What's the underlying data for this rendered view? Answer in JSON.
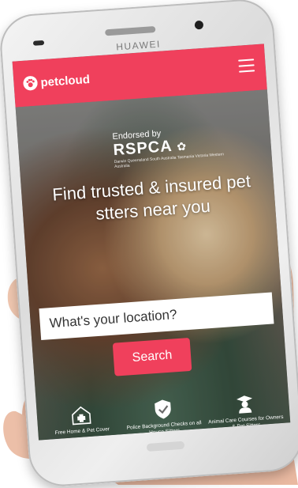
{
  "device": {
    "brand": "HUAWEI"
  },
  "app": {
    "logo_text": "petcloud",
    "accent_color": "#f0405c"
  },
  "hero": {
    "endorse_line": "Endorsed by",
    "endorse_org": "RSPCA",
    "endorse_sub": "Darwin Queensland South Australia Tasmania Victoria Western Australia",
    "headline": "Find trusted & insured pet stters near you"
  },
  "search": {
    "placeholder": "What's your location?",
    "button_label": "Search"
  },
  "features": [
    {
      "icon": "house-medical-icon",
      "label": "Free Home & Pet Cover"
    },
    {
      "icon": "shield-check-icon",
      "label": "Police Background Checks on all House Sitters"
    },
    {
      "icon": "graduate-icon",
      "label": "Animal Care Courses for Owners & Pet Sitters"
    }
  ]
}
